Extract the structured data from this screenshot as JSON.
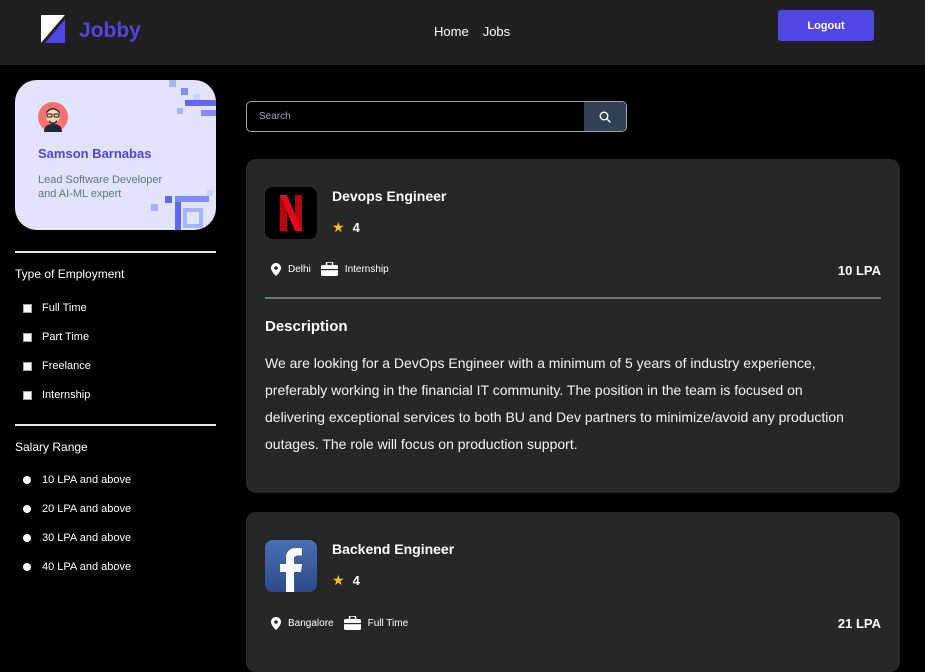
{
  "header": {
    "brand": "Jobby",
    "nav": [
      "Home",
      "Jobs"
    ],
    "logout_label": "Logout"
  },
  "profile": {
    "name": "Samson Barnabas",
    "bio": "Lead Software Developer and AI-ML expert"
  },
  "filters": {
    "employment_title": "Type of Employment",
    "employment_options": [
      "Full Time",
      "Part Time",
      "Freelance",
      "Internship"
    ],
    "salary_title": "Salary Range",
    "salary_options": [
      "10 LPA and above",
      "20 LPA and above",
      "30 LPA and above",
      "40 LPA and above"
    ]
  },
  "search": {
    "placeholder": "Search",
    "icon": "search-icon"
  },
  "jobs": [
    {
      "title": "Devops Engineer",
      "company_logo": "netflix-logo",
      "rating": "4",
      "location": "Delhi",
      "employment_type": "Internship",
      "package": "10 LPA",
      "description_heading": "Description",
      "description": "We are looking for a DevOps Engineer with a minimum of 5 years of industry experience, preferably working in the financial IT community. The position in the team is focused on delivering exceptional services to both BU and Dev partners to minimize/avoid any production outages. The role will focus on production support."
    },
    {
      "title": "Backend Engineer",
      "company_logo": "facebook-logo",
      "rating": "4",
      "location": "Bangalore",
      "employment_type": "Full Time",
      "package": "21 LPA"
    }
  ],
  "colors": {
    "accent": "#4f46e5",
    "navbar_bg": "#202020",
    "card_bg": "#272727",
    "profile_bg": "#e2e3fe",
    "star": "#fbbf24"
  }
}
